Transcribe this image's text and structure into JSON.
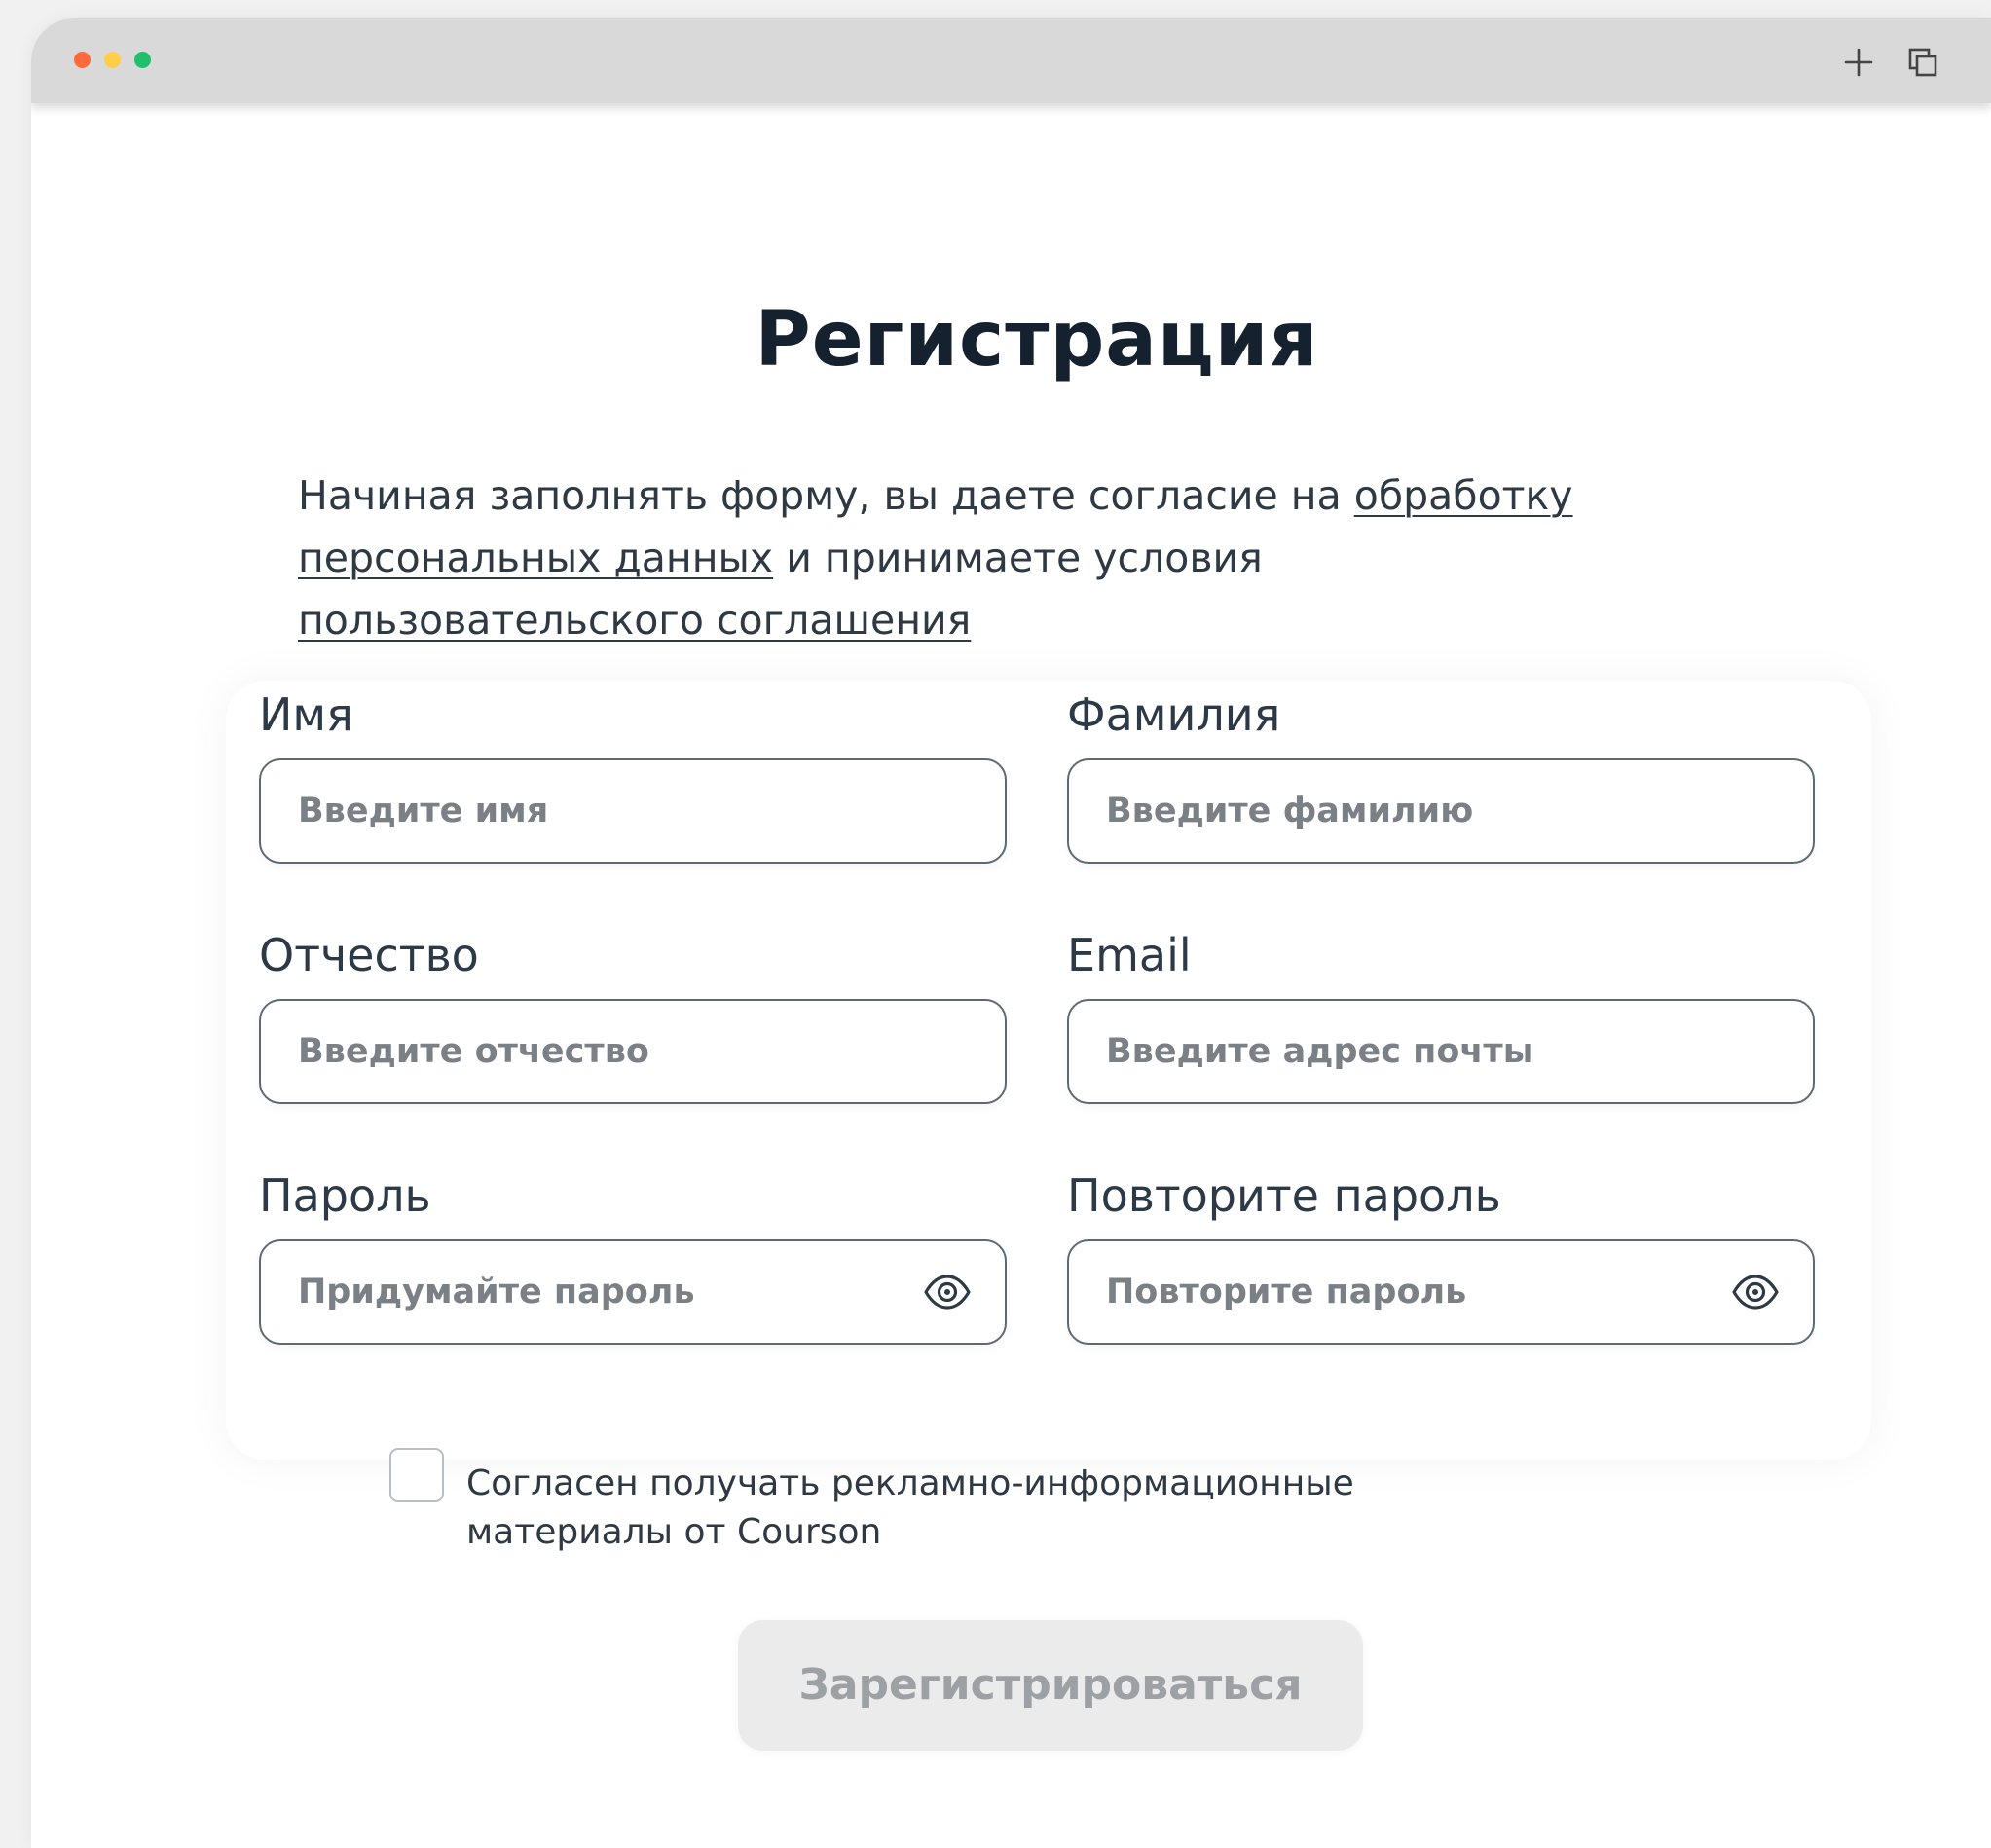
{
  "window": {
    "traffic_lights": [
      "#ff6a3d",
      "#ffcf4a",
      "#1fbf6c"
    ],
    "toolbar_icons": [
      "plus-icon",
      "copy-icon"
    ]
  },
  "page": {
    "title": "Регистрация",
    "intro": {
      "text_1": "Начиная заполнять форму, вы даете согласие на ",
      "link_1": "обработку персональных данных",
      "text_2": " и принимаете условия ",
      "link_2": "пользовательского соглашения"
    }
  },
  "form": {
    "first_name": {
      "label": "Имя",
      "placeholder": "Введите имя"
    },
    "last_name": {
      "label": "Фамилия",
      "placeholder": "Введите фамилию"
    },
    "middle_name": {
      "label": "Отчество",
      "placeholder": "Введите отчество"
    },
    "email": {
      "label": "Email",
      "placeholder": "Введите адрес почты"
    },
    "password": {
      "label": "Пароль",
      "placeholder": "Придумайте пароль",
      "icon": "eye-icon"
    },
    "password_repeat": {
      "label": "Повторите пароль",
      "placeholder": "Повторите пароль",
      "icon": "eye-icon"
    },
    "consent": {
      "label": "Согласен получать рекламно-информационные материалы от Courson",
      "checked": false
    },
    "submit_label": "Зарегистрироваться"
  },
  "colors": {
    "title": "#15212e",
    "text": "#2f3944",
    "input_border": "#5d6a76",
    "placeholder": "#7b8087",
    "button_disabled_bg": "#ebebeb",
    "button_disabled_text": "#9da1a6"
  }
}
